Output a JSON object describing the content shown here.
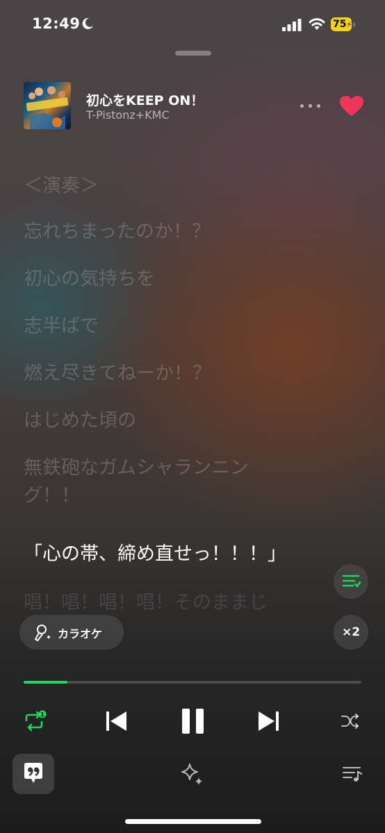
{
  "status_bar": {
    "time": "12:49",
    "battery": "75"
  },
  "now_playing": {
    "title": "初心をKEEP ON！",
    "artist": "T-Pistonz+KMC"
  },
  "lyrics": [
    "＜演奏＞",
    "忘れちまったのか！？",
    "初心の気持ちを",
    "志半ばで",
    "燃え尽きてねーか！？",
    "はじめた頃の",
    "無鉄砲なガムシャランニン",
    "グ！！",
    "「心の帯、締め直せっ！！！」",
    "唱！唱！唱！唱！そのままじ"
  ],
  "active_lyric_index": 8,
  "karaoke": {
    "label": "カラオケ"
  },
  "speed": {
    "label": "×2"
  },
  "progress": {
    "fraction": 0.13
  },
  "repeat": {
    "badge": "1"
  },
  "colors": {
    "accent": "#1ed760",
    "heart": "#f0355b",
    "battery": "#f2d21b"
  },
  "icons": [
    "moon-icon",
    "signal-icon",
    "wifi-icon",
    "heart-icon",
    "more-icon",
    "lyrics-list-icon",
    "microphone-icon",
    "repeat-icon",
    "previous-icon",
    "pause-icon",
    "next-icon",
    "shuffle-icon",
    "lyrics-quote-icon",
    "sparkle-icon",
    "queue-icon"
  ]
}
